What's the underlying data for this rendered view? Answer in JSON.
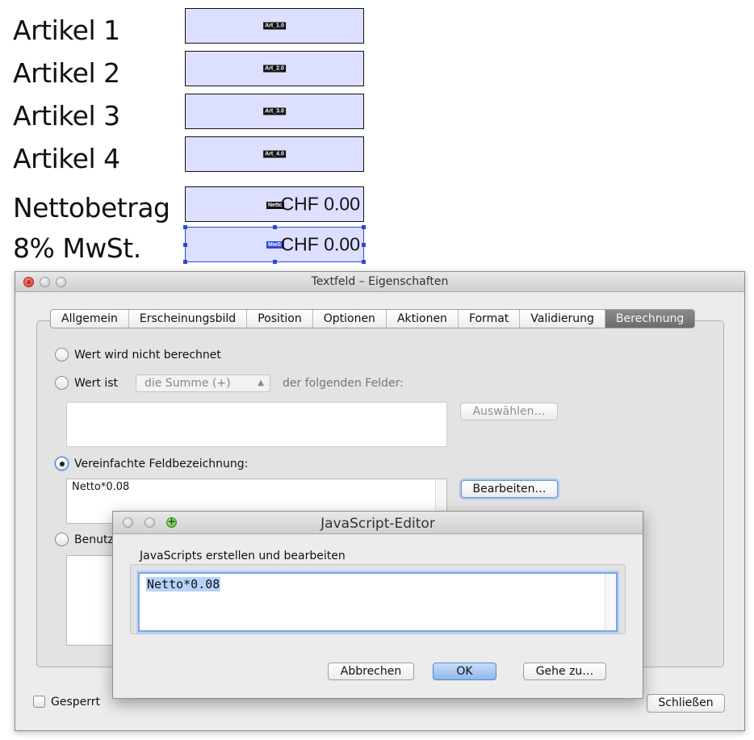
{
  "form": {
    "rows": [
      {
        "label": "Artikel 1",
        "tag": "Art_1.0"
      },
      {
        "label": "Artikel 2",
        "tag": "Art_2.0"
      },
      {
        "label": "Artikel 3",
        "tag": "Art_3.0"
      },
      {
        "label": "Artikel 4",
        "tag": "Art_4.0"
      }
    ],
    "netto": {
      "label": "Nettobetrag",
      "tag": "Netto",
      "value": "CHF 0.00"
    },
    "mwst": {
      "label": "8% MwSt.",
      "tag": "MwSt",
      "value": "CHF 0.00"
    }
  },
  "window": {
    "title": "Textfeld – Eigenschaften",
    "tabs": [
      "Allgemein",
      "Erscheinungsbild",
      "Position",
      "Optionen",
      "Aktionen",
      "Format",
      "Validierung",
      "Berechnung"
    ],
    "active_tab": "Berechnung",
    "radio_not_calculated": "Wert wird nicht berechnet",
    "radio_value_is": "Wert ist",
    "popup_value": "die Summe (+)",
    "fields_label": "der folgenden Felder:",
    "select_button": "Auswählen…",
    "radio_simplified": "Vereinfachte Feldbezeichnung:",
    "simplified_value": "Netto*0.08",
    "edit_button": "Bearbeiten…",
    "radio_custom": "Benutz",
    "locked_label": "Gesperrt",
    "close_button": "Schließen"
  },
  "editor": {
    "title": "JavaScript-Editor",
    "group_label": "JavaScripts erstellen und bearbeiten",
    "code": "Netto*0.08",
    "cancel_button": "Abbrechen",
    "ok_button": "OK",
    "goto_button": "Gehe zu…"
  }
}
